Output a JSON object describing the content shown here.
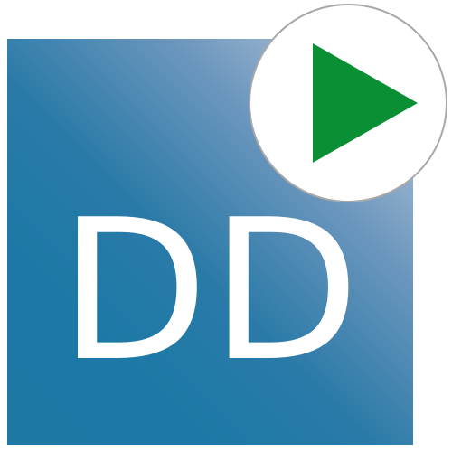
{
  "logo": {
    "text": "DD",
    "text_color": "#ffffff",
    "tile_colors": [
      "#c3cfe0",
      "#1c79a5"
    ]
  },
  "badge": {
    "icon": "play-icon",
    "icon_color": "#0a8f35",
    "background": "#ffffff",
    "border_color": "#a8a8a8"
  }
}
